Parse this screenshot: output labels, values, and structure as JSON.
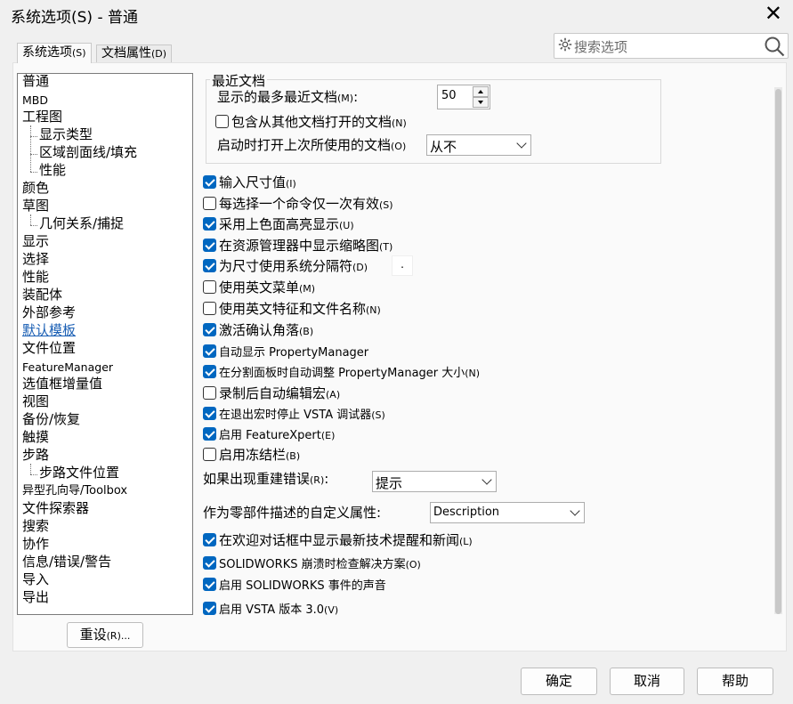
{
  "window": {
    "title": "系统选项(S) - 普通",
    "close_glyph": "✕"
  },
  "tabs": [
    {
      "label": "系统选项",
      "key": "(S)"
    },
    {
      "label": "文档属性",
      "key": "(D)"
    }
  ],
  "search": {
    "placeholder": "搜索选项",
    "icons": [
      "gear-icon",
      "magnifier-icon"
    ]
  },
  "tree": {
    "items": [
      "普通",
      "MBD",
      "工程图",
      "显示类型",
      "区域剖面线/填充",
      "性能",
      "颜色",
      "草图",
      "几何关系/捕捉",
      "显示",
      "选择",
      "性能",
      "装配体",
      "外部参考",
      "默认模板",
      "文件位置",
      "FeatureManager",
      "选值框增量值",
      "视图",
      "备份/恢复",
      "触摸",
      "步路",
      "步路文件位置",
      "异型孔向导/Toolbox",
      "文件探索器",
      "搜索",
      "协作",
      "信息/错误/警告",
      "导入",
      "导出"
    ]
  },
  "reset_button": {
    "label": "重设",
    "key": "(R)..."
  },
  "recent_docs": {
    "legend": "最近文档",
    "max_label": "显示的最多最近文档",
    "max_key": "(M)",
    "max_colon": ":",
    "max_value": "50",
    "include_label": "包含从其他文档打开的文档",
    "include_key": "(N)",
    "startup_label": "启动时打开上次所使用的文档",
    "startup_key": "(O)",
    "startup_value": "从不"
  },
  "separator_value": ".",
  "options": [
    {
      "label": "输入尺寸值",
      "key": "(I)",
      "checked": true
    },
    {
      "label": "每选择一个命令仅一次有效",
      "key": "(S)",
      "checked": false
    },
    {
      "label": "采用上色面高亮显示",
      "key": "(U)",
      "checked": true
    },
    {
      "label": "在资源管理器中显示缩略图",
      "key": "(T)",
      "checked": true
    },
    {
      "label": "为尺寸使用系统分隔符",
      "key": "(D)",
      "checked": true
    },
    {
      "label": "使用英文菜单",
      "key": "(M)",
      "checked": false
    },
    {
      "label": "使用英文特征和文件名称",
      "key": "(N)",
      "checked": false
    },
    {
      "label": "激活确认角落",
      "key": "(B)",
      "checked": true
    },
    {
      "label": "自动显示 PropertyManager",
      "key": "",
      "checked": true
    },
    {
      "label": "在分割面板时自动调整 PropertyManager 大小",
      "key": "(N)",
      "checked": true
    },
    {
      "label": "录制后自动编辑宏",
      "key": "(A)",
      "checked": false
    },
    {
      "label": "在退出宏时停止 VSTA 调试器",
      "key": "(S)",
      "checked": true
    },
    {
      "label": "启用 FeatureXpert",
      "key": "(E)",
      "checked": true
    },
    {
      "label": "启用冻结栏",
      "key": "(B)",
      "checked": false
    }
  ],
  "rebuild_error": {
    "label": "如果出现重建错误",
    "key": "(R)",
    "colon": ":",
    "value": "提示"
  },
  "custom_property": {
    "label": "作为零部件描述的自定义属性:",
    "value": "Description"
  },
  "options2": [
    {
      "label": "在欢迎对话框中显示最新技术提醒和新闻",
      "key": "(L)",
      "checked": true
    },
    {
      "label": "SOLIDWORKS 崩溃时检查解决方案",
      "key": "(O)",
      "checked": true
    },
    {
      "label": "启用 SOLIDWORKS 事件的声音",
      "key": "",
      "checked": true
    },
    {
      "label": "启用 VSTA 版本 3.0",
      "key": "(V)",
      "checked": true
    }
  ],
  "footer": {
    "ok": "确定",
    "cancel": "取消",
    "help": "帮助"
  },
  "colors": {
    "accent": "#0067c0",
    "link": "#1a5fb4"
  }
}
